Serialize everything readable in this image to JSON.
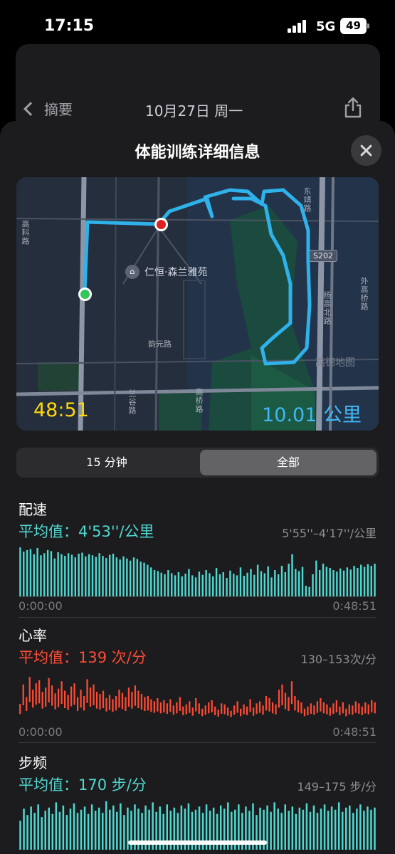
{
  "status_bar": {
    "time": "17:15",
    "network": "5G",
    "battery": "49"
  },
  "nav": {
    "back_label": "摘要",
    "date": "10月27日 周一"
  },
  "sheet": {
    "title": "体能训练详细信息"
  },
  "map": {
    "duration": "48:51",
    "distance": "10.01 公里",
    "poi_name": "仁恒·森兰雅苑",
    "road_shield": "S202",
    "road_labels": [
      "高科路",
      "韵元路",
      "兰谷路",
      "高桥路",
      "杨高北路",
      "东靖路",
      "外高桥路"
    ],
    "map_watermark": "高德地图"
  },
  "segments": {
    "option_1": "15 分钟",
    "option_2": "全部",
    "selected": "全部"
  },
  "colors": {
    "pace": "#4fd8d0",
    "heart_rate": "#ff4a34",
    "cadence": "#4fd8d0"
  },
  "metrics": {
    "pace": {
      "title": "配速",
      "average": "平均值：4'53''/公里",
      "range": "5'55''–4'17''/公里",
      "start_time": "0:00:00",
      "end_time": "0:48:51"
    },
    "heart_rate": {
      "title": "心率",
      "average": "平均值：139 次/分",
      "range": "130–153次/分",
      "start_time": "0:00:00",
      "end_time": "0:48:51"
    },
    "cadence": {
      "title": "步频",
      "average": "平均值：170 步/分",
      "range": "149–175 步/分"
    }
  },
  "chart_data": [
    {
      "type": "bar",
      "series": [
        {
          "name": "配速",
          "values": [
            0.93,
            0.85,
            0.88,
            0.9,
            0.8,
            0.92,
            0.78,
            0.82,
            0.88,
            0.86,
            0.72,
            0.84,
            0.8,
            0.77,
            0.82,
            0.79,
            0.74,
            0.81,
            0.83,
            0.76,
            0.8,
            0.78,
            0.75,
            0.82,
            0.77,
            0.73,
            0.79,
            0.81,
            0.74,
            0.7,
            0.76,
            0.72,
            0.68,
            0.74,
            0.71,
            0.66,
            0.64,
            0.6,
            0.55,
            0.5,
            0.48,
            0.45,
            0.42,
            0.5,
            0.44,
            0.4,
            0.46,
            0.38,
            0.43,
            0.52,
            0.4,
            0.36,
            0.47,
            0.41,
            0.5,
            0.44,
            0.38,
            0.54,
            0.42,
            0.46,
            0.35,
            0.49,
            0.43,
            0.4,
            0.55,
            0.39,
            0.45,
            0.52,
            0.41,
            0.6,
            0.48,
            0.44,
            0.57,
            0.36,
            0.5,
            0.42,
            0.58,
            0.46,
            0.62,
            0.8,
            0.52,
            0.48,
            0.56,
            0.2,
            0.18,
            0.42,
            0.68,
            0.5,
            0.62,
            0.56,
            0.54,
            0.5,
            0.47,
            0.53,
            0.49,
            0.55,
            0.51,
            0.58,
            0.54,
            0.6,
            0.56,
            0.61,
            0.58,
            0.62
          ]
        }
      ],
      "xlim_label": [
        "0:00:00",
        "0:48:51"
      ]
    },
    {
      "type": "bar",
      "series": [
        {
          "name": "心率",
          "values": [
            0.35,
            0.72,
            0.48,
            0.86,
            0.62,
            0.74,
            0.8,
            0.58,
            0.66,
            0.84,
            0.7,
            0.55,
            0.64,
            0.78,
            0.6,
            0.52,
            0.68,
            0.74,
            0.48,
            0.62,
            0.5,
            0.82,
            0.66,
            0.72,
            0.58,
            0.54,
            0.6,
            0.46,
            0.52,
            0.44,
            0.5,
            0.62,
            0.56,
            0.48,
            0.66,
            0.58,
            0.7,
            0.6,
            0.54,
            0.48,
            0.5,
            0.44,
            0.4,
            0.46,
            0.38,
            0.42,
            0.36,
            0.44,
            0.32,
            0.38,
            0.48,
            0.3,
            0.34,
            0.4,
            0.28,
            0.46,
            0.36,
            0.26,
            0.32,
            0.38,
            0.42,
            0.3,
            0.24,
            0.36,
            0.34,
            0.28,
            0.22,
            0.32,
            0.4,
            0.26,
            0.34,
            0.3,
            0.44,
            0.28,
            0.36,
            0.4,
            0.32,
            0.5,
            0.46,
            0.38,
            0.34,
            0.62,
            0.72,
            0.56,
            0.48,
            0.78,
            0.5,
            0.42,
            0.38,
            0.26,
            0.3,
            0.36,
            0.32,
            0.4,
            0.46,
            0.38,
            0.34,
            0.28,
            0.36,
            0.42,
            0.3,
            0.38,
            0.26,
            0.34,
            0.32,
            0.4,
            0.36,
            0.3,
            0.38,
            0.34,
            0.42,
            0.38
          ]
        }
      ],
      "xlim_label": [
        "0:00:00",
        "0:48:51"
      ]
    },
    {
      "type": "bar",
      "series": [
        {
          "name": "步频",
          "values": [
            0.55,
            0.78,
            0.66,
            0.82,
            0.7,
            0.86,
            0.62,
            0.74,
            0.8,
            0.68,
            0.9,
            0.72,
            0.84,
            0.66,
            0.78,
            0.88,
            0.7,
            0.76,
            0.82,
            0.68,
            0.86,
            0.74,
            0.8,
            0.7,
            0.92,
            0.76,
            0.84,
            0.72,
            0.88,
            0.66,
            0.8,
            0.74,
            0.86,
            0.78,
            0.7,
            0.84,
            0.76,
            0.9,
            0.72,
            0.82,
            0.68,
            0.86,
            0.74,
            0.8,
            0.7,
            0.84,
            0.78,
            0.88,
            0.72,
            0.76,
            0.82,
            0.7,
            0.86,
            0.74,
            0.8,
            0.68,
            0.84,
            0.78,
            0.9,
            0.72,
            0.76,
            0.86,
            0.7,
            0.82,
            0.74,
            0.88,
            0.66,
            0.8,
            0.76,
            0.84,
            0.72,
            0.9,
            0.78,
            0.7,
            0.86,
            0.74,
            0.82,
            0.68,
            0.8,
            0.76,
            0.88,
            0.72,
            0.84,
            0.7,
            0.78,
            0.86,
            0.74,
            0.82,
            0.76,
            0.9,
            0.72,
            0.8,
            0.84,
            0.7,
            0.78,
            0.86,
            0.74,
            0.82,
            0.76,
            0.8
          ]
        }
      ]
    }
  ]
}
